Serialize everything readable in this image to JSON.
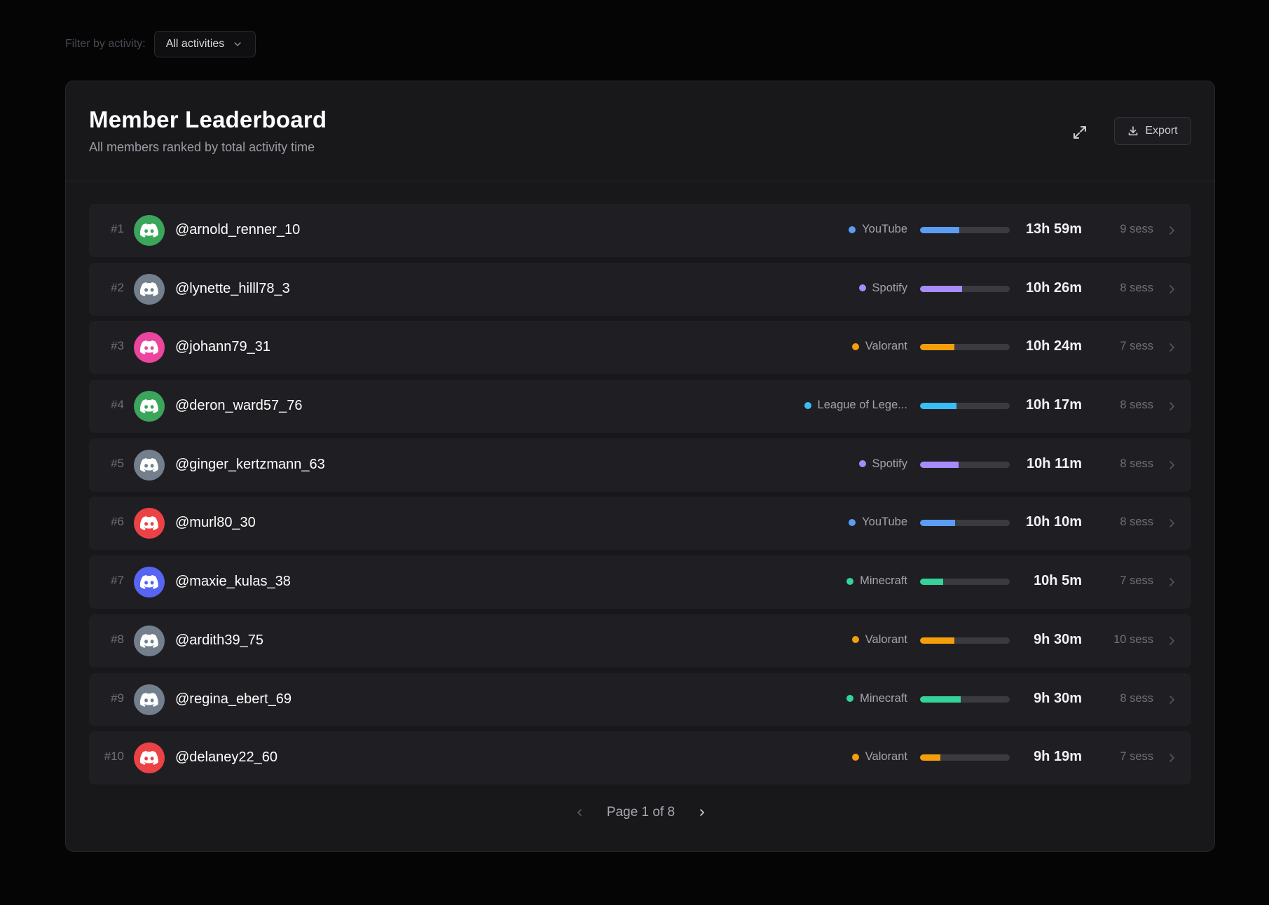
{
  "filter": {
    "label": "Filter by activity:",
    "selected": "All activities"
  },
  "header": {
    "title": "Member Leaderboard",
    "subtitle": "All members ranked by total activity time",
    "export_label": "Export"
  },
  "colors": {
    "green": "#3ba55c",
    "gray": "#747f8d",
    "pink": "#eb459e",
    "red": "#ed4245",
    "blurple": "#5865f2",
    "YouTube": "#5b9cf5",
    "Spotify": "#a78bfa",
    "Valorant": "#f59e0b",
    "League of Legends": "#38bdf8",
    "Minecraft": "#34d399"
  },
  "rows": [
    {
      "rank": "#1",
      "username": "@arnold_renner_10",
      "avatar_color": "green",
      "activity": "YouTube",
      "activity_key": "YouTube",
      "progress": 0.44,
      "time": "13h 59m",
      "sessions": "9 sess"
    },
    {
      "rank": "#2",
      "username": "@lynette_hilll78_3",
      "avatar_color": "gray",
      "activity": "Spotify",
      "activity_key": "Spotify",
      "progress": 0.47,
      "time": "10h 26m",
      "sessions": "8 sess"
    },
    {
      "rank": "#3",
      "username": "@johann79_31",
      "avatar_color": "pink",
      "activity": "Valorant",
      "activity_key": "Valorant",
      "progress": 0.38,
      "time": "10h 24m",
      "sessions": "7 sess"
    },
    {
      "rank": "#4",
      "username": "@deron_ward57_76",
      "avatar_color": "green",
      "activity": "League of Lege...",
      "activity_key": "League of Legends",
      "progress": 0.41,
      "time": "10h 17m",
      "sessions": "8 sess"
    },
    {
      "rank": "#5",
      "username": "@ginger_kertzmann_63",
      "avatar_color": "gray",
      "activity": "Spotify",
      "activity_key": "Spotify",
      "progress": 0.43,
      "time": "10h 11m",
      "sessions": "8 sess"
    },
    {
      "rank": "#6",
      "username": "@murl80_30",
      "avatar_color": "red",
      "activity": "YouTube",
      "activity_key": "YouTube",
      "progress": 0.39,
      "time": "10h 10m",
      "sessions": "8 sess"
    },
    {
      "rank": "#7",
      "username": "@maxie_kulas_38",
      "avatar_color": "blurple",
      "activity": "Minecraft",
      "activity_key": "Minecraft",
      "progress": 0.26,
      "time": "10h 5m",
      "sessions": "7 sess"
    },
    {
      "rank": "#8",
      "username": "@ardith39_75",
      "avatar_color": "gray",
      "activity": "Valorant",
      "activity_key": "Valorant",
      "progress": 0.38,
      "time": "9h 30m",
      "sessions": "10 sess"
    },
    {
      "rank": "#9",
      "username": "@regina_ebert_69",
      "avatar_color": "gray",
      "activity": "Minecraft",
      "activity_key": "Minecraft",
      "progress": 0.45,
      "time": "9h 30m",
      "sessions": "8 sess"
    },
    {
      "rank": "#10",
      "username": "@delaney22_60",
      "avatar_color": "red",
      "activity": "Valorant",
      "activity_key": "Valorant",
      "progress": 0.23,
      "time": "9h 19m",
      "sessions": "7 sess"
    }
  ],
  "pagination": {
    "label": "Page 1 of 8"
  }
}
